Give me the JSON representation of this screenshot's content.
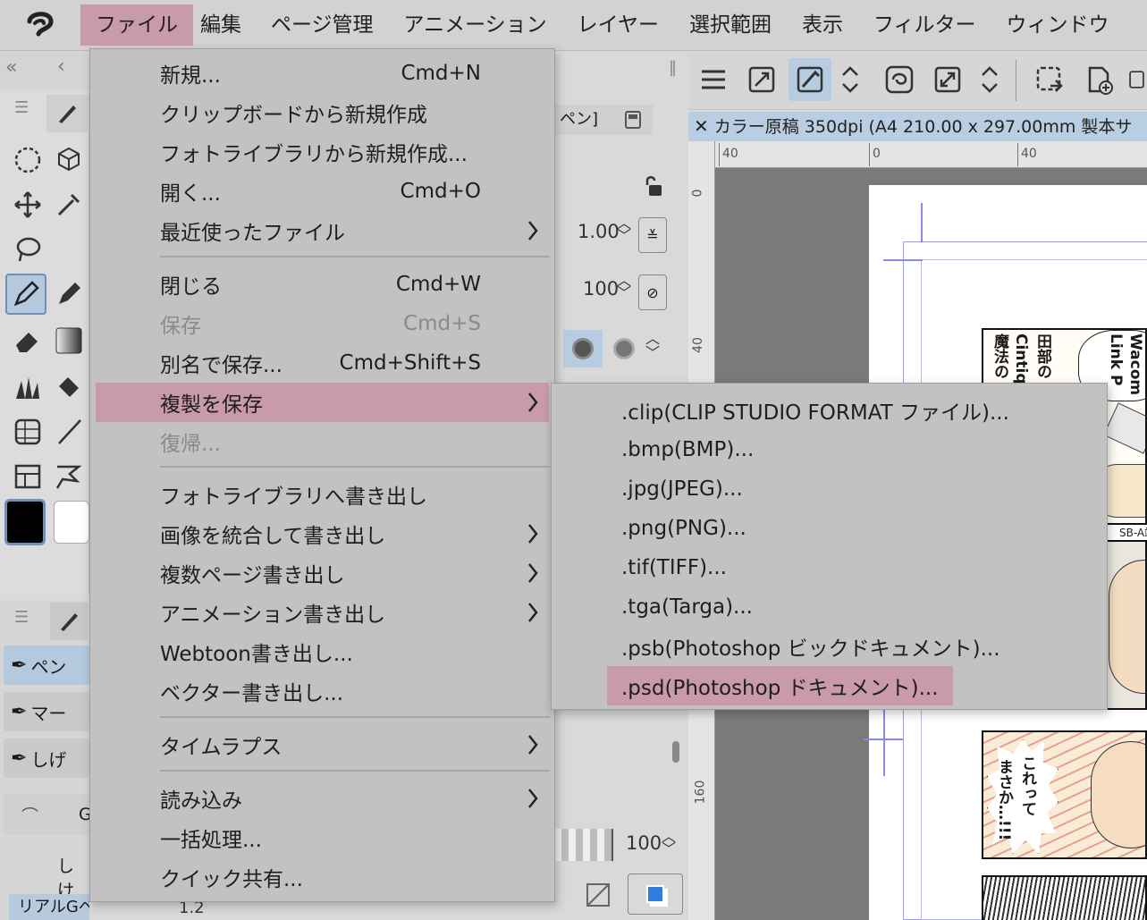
{
  "menubar": {
    "items": [
      {
        "label": "ファイル",
        "active": true
      },
      {
        "label": "編集"
      },
      {
        "label": "ページ管理"
      },
      {
        "label": "アニメーション"
      },
      {
        "label": "レイヤー"
      },
      {
        "label": "選択範囲"
      },
      {
        "label": "表示"
      },
      {
        "label": "フィルター"
      },
      {
        "label": "ウィンドウ"
      }
    ]
  },
  "file_menu": {
    "items": [
      {
        "label": "新規...",
        "shortcut": "Cmd+N"
      },
      {
        "label": "クリップボードから新規作成"
      },
      {
        "label": "フォトライブラリから新規作成..."
      },
      {
        "label": "開く...",
        "shortcut": "Cmd+O"
      },
      {
        "label": "最近使ったファイル",
        "submenu": true
      },
      {
        "label": "閉じる",
        "shortcut": "Cmd+W"
      },
      {
        "label": "保存",
        "shortcut": "Cmd+S",
        "disabled": true
      },
      {
        "label": "別名で保存...",
        "shortcut": "Cmd+Shift+S"
      },
      {
        "label": "複製を保存",
        "submenu": true,
        "highlighted": true
      },
      {
        "label": "復帰...",
        "disabled": true
      },
      {
        "label": "フォトライブラリへ書き出し"
      },
      {
        "label": "画像を統合して書き出し",
        "submenu": true
      },
      {
        "label": "複数ページ書き出し",
        "submenu": true
      },
      {
        "label": "アニメーション書き出し",
        "submenu": true
      },
      {
        "label": "Webtoon書き出し..."
      },
      {
        "label": "ベクター書き出し..."
      },
      {
        "label": "タイムラプス",
        "submenu": true
      },
      {
        "label": "読み込み",
        "submenu": true
      },
      {
        "label": "一括処理..."
      },
      {
        "label": "クイック共有..."
      }
    ]
  },
  "save_copy_submenu": {
    "items": [
      {
        "label": ".clip(CLIP STUDIO FORMAT ファイル)..."
      },
      {
        "label": ".bmp(BMP)..."
      },
      {
        "label": ".jpg(JPEG)..."
      },
      {
        "label": ".png(PNG)..."
      },
      {
        "label": ".tif(TIFF)..."
      },
      {
        "label": ".tga(Targa)..."
      },
      {
        "label": ".psb(Photoshop ビックドキュメント)..."
      },
      {
        "label": ".psd(Photoshop ドキュメント)...",
        "highlighted": true
      }
    ]
  },
  "subtool_list": {
    "items": [
      {
        "label": "ペン",
        "selected": true
      },
      {
        "label": "マー"
      },
      {
        "label": "しげ"
      }
    ],
    "brush_label": "G",
    "bottom_label": "しけ",
    "bottom_name": "リアルGペン",
    "bottom_value": "1.2"
  },
  "tool_property": {
    "tab_label": "ペン]",
    "brush_size": "1.00",
    "opacity": "100",
    "bottom_opacity": "100"
  },
  "document": {
    "tab_title": "カラー原稿 350dpi (A4 210.00 x 297.00mm 製本サ",
    "ruler_h": [
      "40",
      "0",
      "40"
    ],
    "ruler_v": [
      "0",
      "40",
      "160"
    ]
  },
  "canvas_art": {
    "balloon1_col1": "Wacom",
    "balloon1_col2": "Link P",
    "balloon2_col1": "田部の",
    "balloon2_col2": "Cintiq",
    "balloon2_col3": "魔法の",
    "usb_label": "SB-A端",
    "speech3_col1": "これって",
    "speech3_col2": "まさか…!!!"
  },
  "colors": {
    "menu_bg": "#c2c2c2",
    "menu_highlight": "#c99aaa",
    "selection_blue": "#b4c8de"
  }
}
